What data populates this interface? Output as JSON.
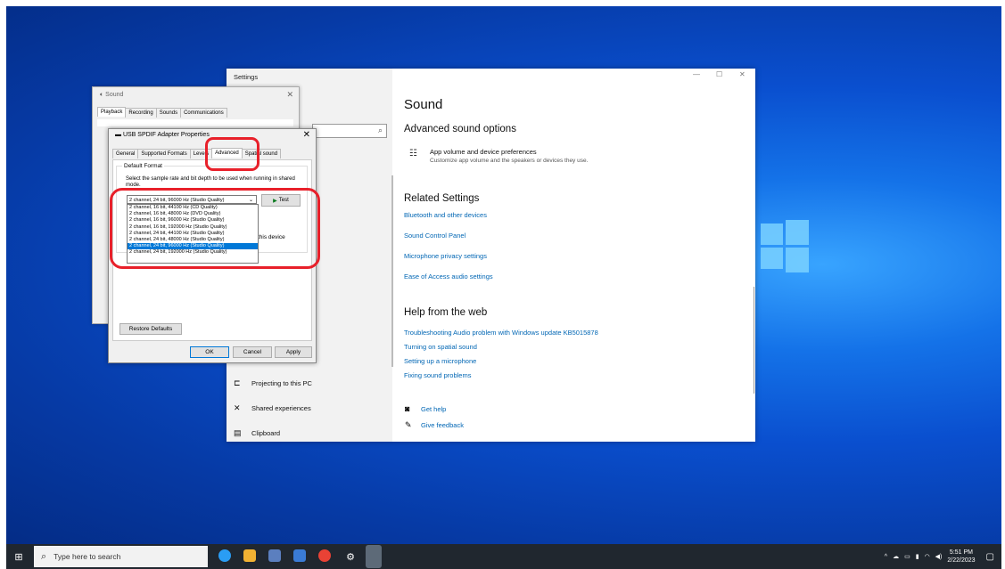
{
  "taskbar": {
    "search_placeholder": "Type here to search",
    "clock_time": "5:51 PM",
    "clock_date": "2/22/2023"
  },
  "settings": {
    "window_title": "Settings",
    "page_title": "Sound",
    "advanced_heading": "Advanced sound options",
    "app_volume_title": "App volume and device preferences",
    "app_volume_desc": "Customize app volume and the speakers or devices they use.",
    "related_heading": "Related Settings",
    "related_links": [
      "Bluetooth and other devices",
      "Sound Control Panel",
      "Microphone privacy settings",
      "Ease of Access audio settings"
    ],
    "help_heading": "Help from the web",
    "help_links": [
      "Troubleshooting Audio problem with Windows update KB5015878",
      "Turning on spatial sound",
      "Setting up a microphone",
      "Fixing sound problems"
    ],
    "get_help": "Get help",
    "give_feedback": "Give feedback",
    "nav_items": [
      "Projecting to this PC",
      "Shared experiences",
      "Clipboard"
    ]
  },
  "sound_dialog": {
    "title": "Sound",
    "tabs": [
      "Playback",
      "Recording",
      "Sounds",
      "Communications"
    ]
  },
  "props_dialog": {
    "title": "USB SPDIF Adapter Properties",
    "tabs": [
      "General",
      "Supported Formats",
      "Levels",
      "Advanced",
      "Spatial sound"
    ],
    "group_label": "Default Format",
    "description": "Select the sample rate and bit depth to be used when running in shared mode.",
    "selected_format": "2 channel, 24 bit, 96000 Hz (Studio Quality)",
    "format_options": [
      "2 channel, 16 bit, 44100 Hz (CD Quality)",
      "2 channel, 16 bit, 48000 Hz (DVD Quality)",
      "2 channel, 16 bit, 96000 Hz (Studio Quality)",
      "2 channel, 16 bit, 192000 Hz (Studio Quality)",
      "2 channel, 24 bit, 44100 Hz (Studio Quality)",
      "2 channel, 24 bit, 48000 Hz (Studio Quality)",
      "2 channel, 24 bit, 96000 Hz (Studio Quality)",
      "2 channel, 24 bit, 192000 Hz (Studio Quality)"
    ],
    "highlighted_option_index": 6,
    "test_label": "Test",
    "partial_text": "this device",
    "restore_label": "Restore Defaults",
    "ok_label": "OK",
    "cancel_label": "Cancel",
    "apply_label": "Apply"
  },
  "colors": {
    "accent": "#0078d7",
    "link": "#0066b4",
    "highlight_circle": "#e8202a"
  }
}
